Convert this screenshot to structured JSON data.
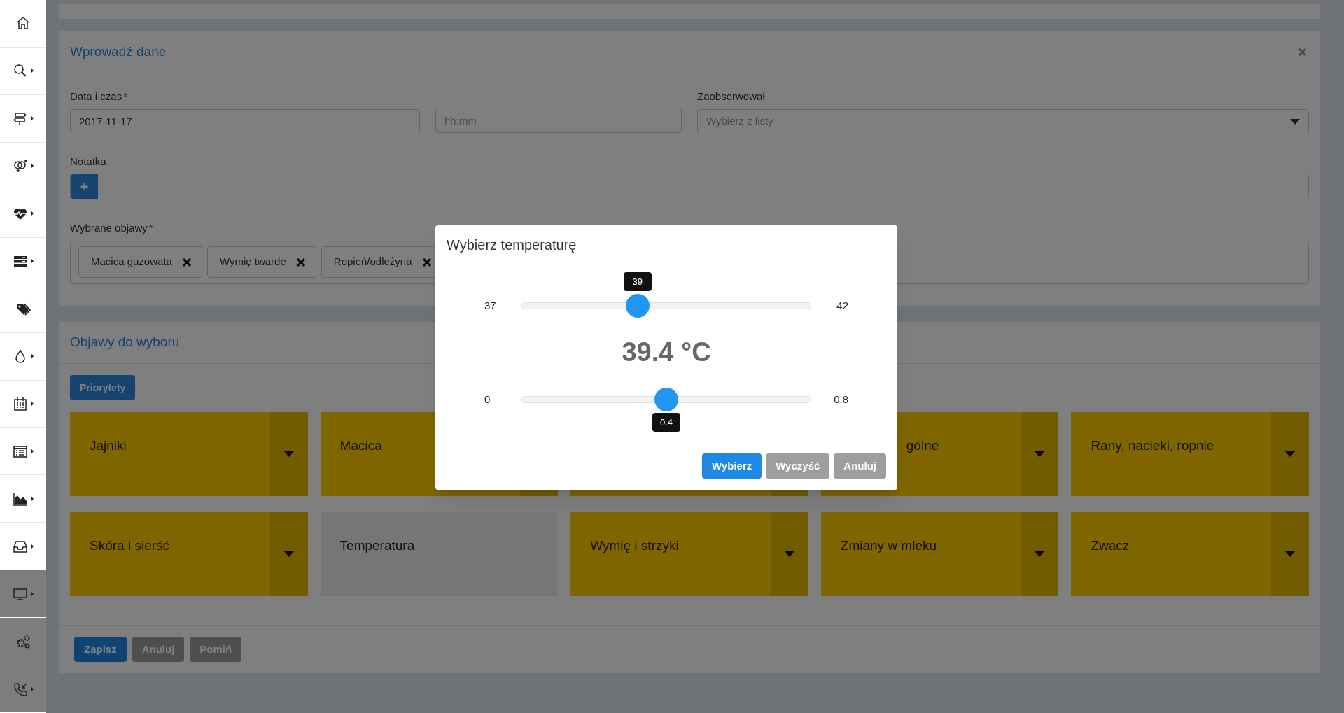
{
  "sidebar": {
    "items": [
      {
        "kind": "primary",
        "expandable": false
      },
      {
        "kind": "primary",
        "expandable": true
      },
      {
        "kind": "primary",
        "expandable": true
      },
      {
        "kind": "primary",
        "expandable": true
      },
      {
        "kind": "primary",
        "expandable": true
      },
      {
        "kind": "primary",
        "expandable": true
      },
      {
        "kind": "primary",
        "expandable": false
      },
      {
        "kind": "primary",
        "expandable": true
      },
      {
        "kind": "primary",
        "expandable": true
      },
      {
        "kind": "primary",
        "expandable": true
      },
      {
        "kind": "primary",
        "expandable": true
      },
      {
        "kind": "primary",
        "expandable": true
      },
      {
        "kind": "secondary",
        "expandable": true
      },
      {
        "kind": "secondary",
        "expandable": false
      },
      {
        "kind": "secondary",
        "expandable": true
      }
    ]
  },
  "entry_card": {
    "title": "Wprowadź dane",
    "close": "×",
    "date_label": "Data i czas",
    "required_mark": "*",
    "date_value": "2017-11-17",
    "time_placeholder": "hh:mm",
    "observer_label": "Zaobserwował",
    "observer_placeholder": "Wybierz z listy",
    "note_label": "Notatka",
    "note_add": "+",
    "symptoms_label": "Wybrane objawy",
    "symptoms_required_mark": "*",
    "symptoms": [
      {
        "label": "Macica guzowata"
      },
      {
        "label": "Wymię twarde"
      },
      {
        "label": "Ropień/odleżyna"
      }
    ]
  },
  "choice_card": {
    "title": "Objawy do wyboru",
    "priority_button": "Priorytety",
    "tiles": [
      {
        "label": "Jajniki",
        "selected": false
      },
      {
        "label": "Macica",
        "selected": false,
        "caret": false
      },
      {
        "selected": false,
        "caret": false
      },
      {
        "label": "gólne",
        "selected": false,
        "cut": true
      },
      {
        "label": "Rany, nacieki, ropnie",
        "selected": false
      },
      {
        "label": "Skóra i sierść",
        "selected": false
      },
      {
        "label": "Temperatura",
        "selected": true
      },
      {
        "label": "Wymię i strzyki",
        "selected": false
      },
      {
        "label": "Zmiany w mleku",
        "selected": false
      },
      {
        "label": "Żwacz",
        "selected": false
      }
    ],
    "footer_buttons": [
      {
        "label": "Zapisz",
        "kind": "primary"
      },
      {
        "label": "Anuluj",
        "kind": "secondary"
      },
      {
        "label": "Pomiń",
        "kind": "secondary"
      }
    ]
  },
  "modal": {
    "title": "Wybierz temperaturę",
    "sliders": [
      {
        "min": "37",
        "max": "42",
        "tooltip": "39",
        "kind": "above",
        "level": 0.4
      },
      {
        "min": "0",
        "max": "0.8",
        "tooltip": "0.4",
        "kind": "below",
        "level": 0.5
      }
    ],
    "reading": "39.4 °C",
    "buttons": [
      {
        "label": "Wybierz",
        "kind": "primary"
      },
      {
        "label": "Wyczyść",
        "kind": "secondary"
      },
      {
        "label": "Anuluj",
        "kind": "secondary"
      }
    ]
  }
}
